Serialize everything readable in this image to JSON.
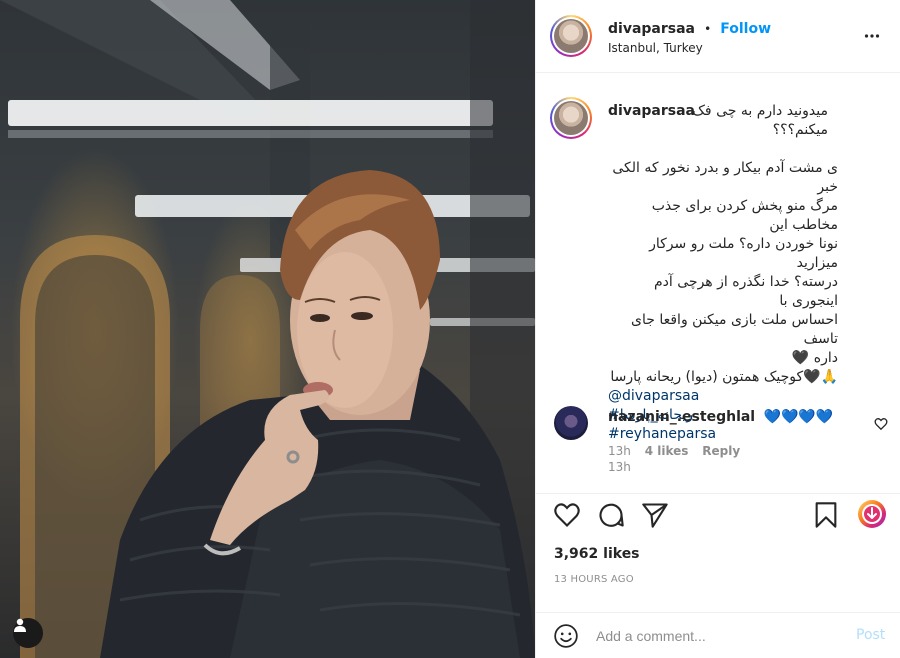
{
  "post": {
    "author": "divaparsaa",
    "separator": "•",
    "follow_label": "Follow",
    "location": "Istanbul, Turkey"
  },
  "caption": {
    "username": "divaparsaa",
    "lines": [
      "میدونید دارم به چی فک",
      "میکنم؟؟؟",
      "",
      "ی مشت آدم بیکار و بدرد نخور که الکی خبر",
      "مرگ منو پخش کردن برای جذب مخاطب این",
      "نونا خوردن داره؟ ملت رو سرکار میزارید",
      "درسته؟ خدا نگذره از هرچی آدم اینجوری با",
      "احساس ملت بازی میکنن واقعا جای تاسف",
      "داره 🖤",
      "🙏🖤کوچیک همتون (دیوا) ریحانه پارسا"
    ],
    "mention": "@divaparsaa",
    "hashtag1": "#ریحانه_پارسا",
    "hashtag2": "#reyhaneparsa",
    "time": "13h"
  },
  "comment": {
    "username": "nazanin_.esteghlal",
    "text": "💙💙💙💙",
    "time": "13h",
    "likes": "4 likes",
    "reply": "Reply"
  },
  "stats": {
    "likes": "3,962 likes",
    "time_ago": "13 HOURS AGO"
  },
  "add_comment": {
    "placeholder": "Add a comment...",
    "post_label": "Post"
  },
  "colors": {
    "accent": "#0095f6",
    "link": "#00376b",
    "heart_blue": "#1877f2",
    "sweater": "#24282e"
  }
}
